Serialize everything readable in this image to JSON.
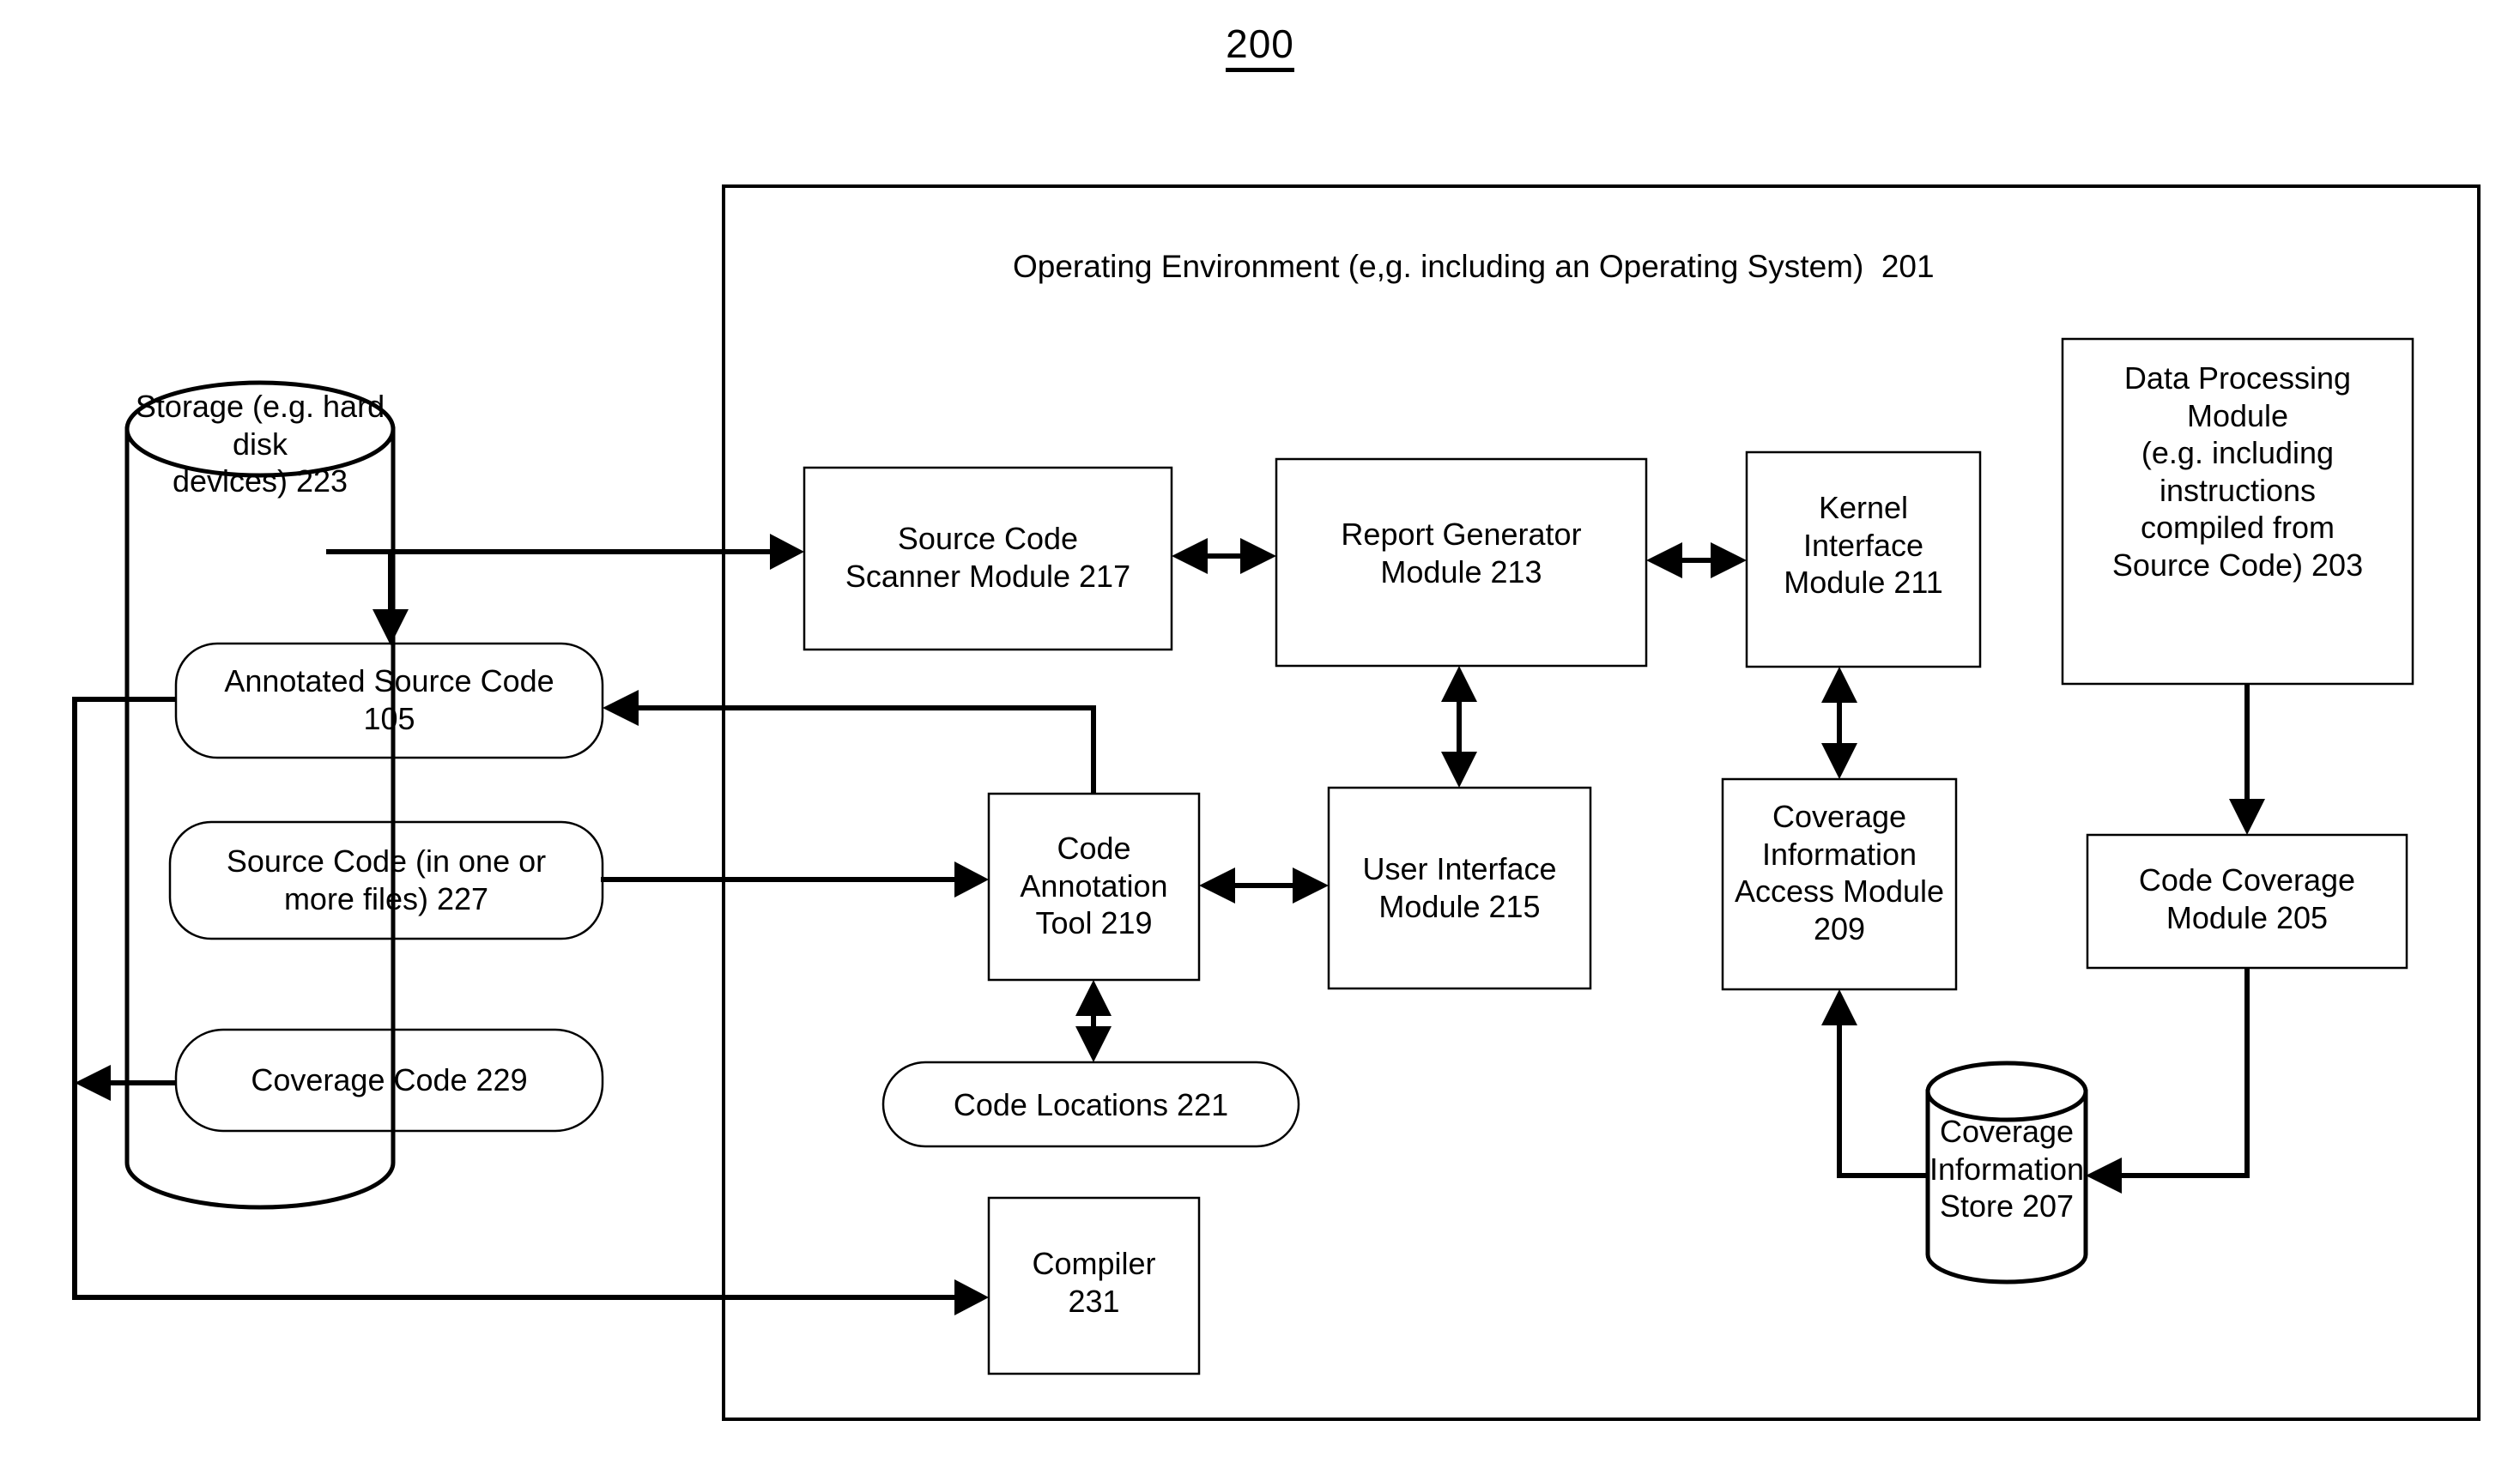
{
  "figure": {
    "number": "200",
    "type": "block-diagram"
  },
  "environment": {
    "label": "Operating Environment (e,g. including an Operating System)  201"
  },
  "storage": {
    "title": "Storage (e.g. hard disk\ndevices) 223",
    "items": [
      {
        "id": "annotated-source-code",
        "label": "Annotated Source Code\n105"
      },
      {
        "id": "source-code",
        "label": "Source Code (in one or\nmore files) 227"
      },
      {
        "id": "coverage-code",
        "label": "Coverage Code 229"
      }
    ]
  },
  "modules": {
    "source_code_scanner": "Source Code\nScanner Module 217",
    "report_generator": "Report Generator\nModule 213",
    "kernel_interface": "Kernel\nInterface\nModule 211",
    "data_processing": "Data Processing\nModule\n(e.g. including\ninstructions\ncompiled from\nSource Code) 203",
    "code_annotation_tool": "Code\nAnnotation\nTool 219",
    "user_interface": "User Interface\nModule  215",
    "coverage_info_access": "Coverage\nInformation\nAccess Module\n209",
    "code_coverage": "Code Coverage\nModule 205",
    "code_locations": "Code  Locations 221",
    "compiler": "Compiler\n231",
    "coverage_info_store": "Coverage\nInformation\nStore 207"
  },
  "colors": {
    "stroke": "#000000",
    "background": "#ffffff"
  }
}
